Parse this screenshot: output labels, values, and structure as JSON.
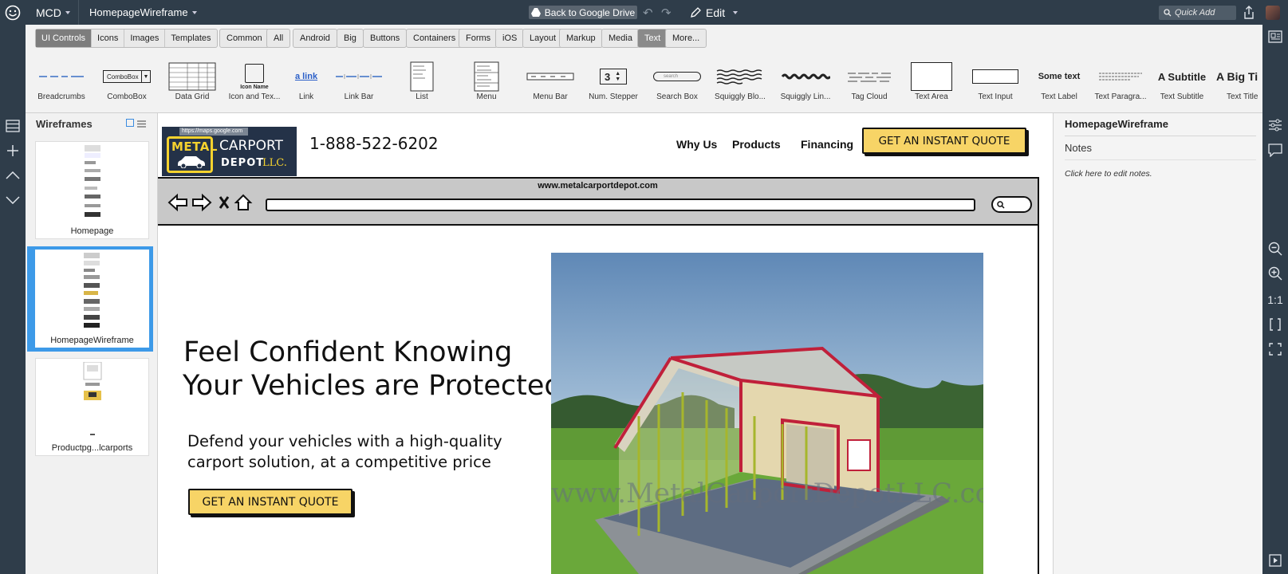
{
  "topbar": {
    "project": "MCD",
    "file": "HomepageWireframe",
    "back_to_drive": "Back to Google Drive",
    "edit": "Edit",
    "quick_add": "Quick Add"
  },
  "toolbar": {
    "view_tabs": [
      "UI Controls",
      "Icons",
      "Images",
      "Templates"
    ],
    "categories": [
      "Common",
      "All",
      "Android",
      "Big",
      "Buttons",
      "Containers",
      "Forms",
      "iOS",
      "Layout",
      "Markup",
      "Media",
      "Text",
      "More..."
    ],
    "selected_category": "Text",
    "palette": [
      {
        "label": "Breadcrumbs",
        "icon": "breadcrumbs-icon"
      },
      {
        "label": "ComboBox",
        "icon": "combobox-icon",
        "preview_text": "ComboBox"
      },
      {
        "label": "Data Grid",
        "icon": "data-grid-icon"
      },
      {
        "label": "Icon and Tex...",
        "icon": "icon-and-text-icon",
        "preview_text": "Icon Name"
      },
      {
        "label": "Link",
        "icon": "link-icon",
        "preview_text": "a link"
      },
      {
        "label": "Link Bar",
        "icon": "link-bar-icon"
      },
      {
        "label": "List",
        "icon": "list-icon"
      },
      {
        "label": "Menu",
        "icon": "menu-icon"
      },
      {
        "label": "Menu Bar",
        "icon": "menu-bar-icon"
      },
      {
        "label": "Num. Stepper",
        "icon": "num-stepper-icon",
        "preview_text": "3"
      },
      {
        "label": "Search Box",
        "icon": "search-box-icon",
        "preview_text": "search"
      },
      {
        "label": "Squiggly Blo...",
        "icon": "squiggly-block-icon"
      },
      {
        "label": "Squiggly Lin...",
        "icon": "squiggly-line-icon"
      },
      {
        "label": "Tag Cloud",
        "icon": "tag-cloud-icon"
      },
      {
        "label": "Text Area",
        "icon": "text-area-icon"
      },
      {
        "label": "Text Input",
        "icon": "text-input-icon"
      },
      {
        "label": "Text Label",
        "icon": "text-label-icon",
        "preview_text": "Some text"
      },
      {
        "label": "Text Paragra...",
        "icon": "text-paragraph-icon"
      },
      {
        "label": "Text Subtitle",
        "icon": "text-subtitle-icon",
        "preview_text": "A Subtitle"
      },
      {
        "label": "Text Title",
        "icon": "text-title-icon",
        "preview_text": "A Big Ti"
      }
    ]
  },
  "wireframes_panel": {
    "title": "Wireframes",
    "items": [
      {
        "label": "Homepage",
        "selected": false
      },
      {
        "label": "HomepageWireframe",
        "selected": true
      },
      {
        "label": "Productpg...lcarports",
        "selected": false
      }
    ]
  },
  "canvas": {
    "logo": {
      "url": "https://maps.google.com",
      "line1a": "METAL",
      "line1b": "CARPORT",
      "line2": "DEPOT",
      "line2b": "LLC."
    },
    "phone": "1-888-522-6202",
    "nav": [
      "Why Us",
      "Products",
      "Financing"
    ],
    "cta_top": "GET AN INSTANT QUOTE",
    "browser_url": "www.metalcarportdepot.com",
    "hero_title_1": "Feel Confident Knowing",
    "hero_title_2": "Your Vehicles are Protected",
    "hero_sub_1": "Defend your vehicles with a high-quality",
    "hero_sub_2": "carport solution, at a competitive price",
    "cta_hero": "GET AN INSTANT QUOTE",
    "watermark": "www.MetalCarportDepotLLC.com",
    "colors": {
      "cta": "#f7d466",
      "logo_bg": "#243248",
      "logo_yellow": "#f5d22e",
      "roof_red": "#c0203a"
    }
  },
  "notes_panel": {
    "title": "HomepageWireframe",
    "notes_label": "Notes",
    "placeholder": "Click here to edit notes."
  }
}
